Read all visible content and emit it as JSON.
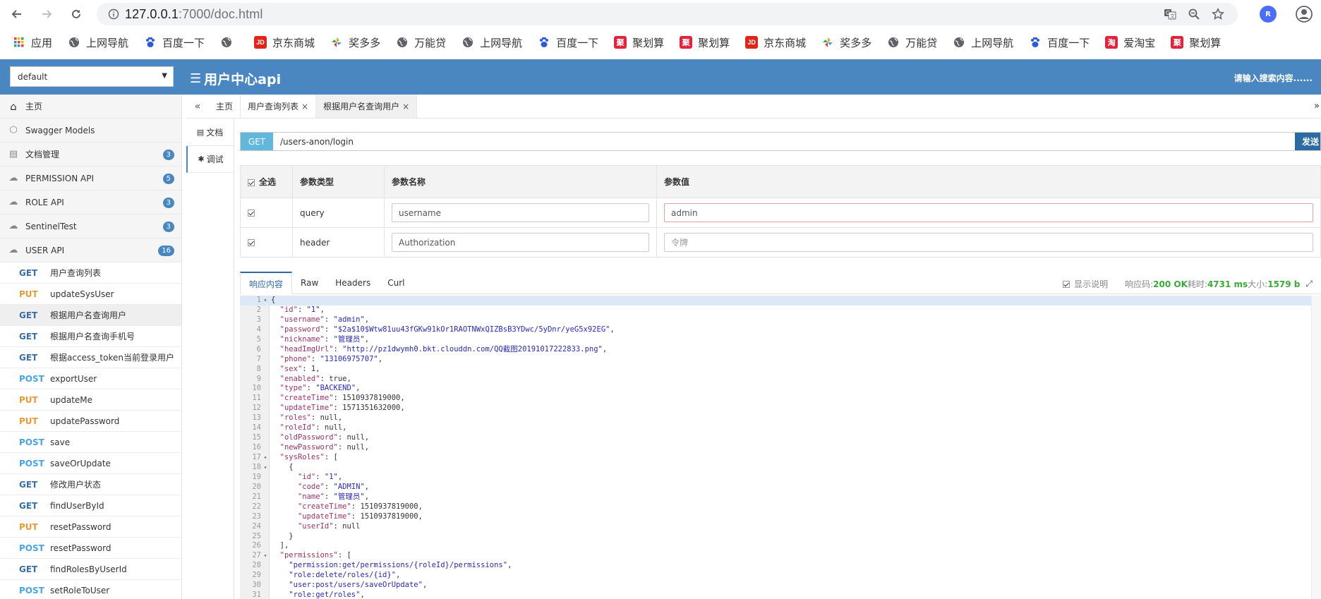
{
  "browser": {
    "url_host": "127.0.0.1",
    "url_rest": ":7000/doc.html",
    "profile_initial": "R",
    "bookmarks": [
      {
        "label": "应用",
        "icon": "apps-grid-icon",
        "color": "#e94335"
      },
      {
        "label": "上网导航",
        "icon": "globe-icon",
        "color": "#5f6368"
      },
      {
        "label": "百度一下",
        "icon": "baidu-paw-icon",
        "color": "#2f5bd9"
      },
      {
        "label": "",
        "icon": "globe-icon",
        "color": "#5f6368"
      },
      {
        "label": "京东商城",
        "icon": "jd-icon",
        "color": "#e1251b"
      },
      {
        "label": "奖多多",
        "icon": "pinwheel-icon",
        "color": "#f0a020"
      },
      {
        "label": "万能贷",
        "icon": "globe-icon",
        "color": "#5f6368"
      },
      {
        "label": "上网导航",
        "icon": "globe-icon",
        "color": "#5f6368"
      },
      {
        "label": "百度一下",
        "icon": "baidu-paw-icon",
        "color": "#2f5bd9"
      },
      {
        "label": "聚划算",
        "icon": "juhuasuan-icon",
        "color": "#e2233c"
      },
      {
        "label": "聚划算",
        "icon": "juhuasuan-icon",
        "color": "#e2233c"
      },
      {
        "label": "京东商城",
        "icon": "jd-icon",
        "color": "#e1251b"
      },
      {
        "label": "奖多多",
        "icon": "pinwheel-icon",
        "color": "#f0a020"
      },
      {
        "label": "万能贷",
        "icon": "globe-icon",
        "color": "#5f6368"
      },
      {
        "label": "上网导航",
        "icon": "globe-icon",
        "color": "#5f6368"
      },
      {
        "label": "百度一下",
        "icon": "baidu-paw-icon",
        "color": "#2f5bd9"
      },
      {
        "label": "爱淘宝",
        "icon": "taobao-icon",
        "color": "#e2233c"
      },
      {
        "label": "聚划算",
        "icon": "juhuasuan-icon",
        "color": "#e2233c"
      }
    ]
  },
  "header": {
    "group_select": "default",
    "title": "用户中心api",
    "search_hint": "请输入搜索内容......",
    "brand_color": "#4a87c0"
  },
  "sidebar": {
    "items": [
      {
        "label": "主页",
        "icon": "home-icon",
        "badge": ""
      },
      {
        "label": "Swagger Models",
        "icon": "cube-icon",
        "badge": ""
      },
      {
        "label": "文档管理",
        "icon": "doc-settings-icon",
        "badge": "3"
      },
      {
        "label": "PERMISSION API",
        "icon": "cloud-icon",
        "badge": "5"
      },
      {
        "label": "ROLE API",
        "icon": "cloud-icon",
        "badge": "3"
      },
      {
        "label": "SentinelTest",
        "icon": "cloud-icon",
        "badge": "3"
      },
      {
        "label": "USER API",
        "icon": "cloud-icon",
        "badge": "16"
      }
    ],
    "apis": [
      {
        "method": "GET",
        "name": "用户查询列表"
      },
      {
        "method": "PUT",
        "name": "updateSysUser"
      },
      {
        "method": "GET",
        "name": "根据用户名查询用户",
        "active": true
      },
      {
        "method": "GET",
        "name": "根据用户名查询手机号"
      },
      {
        "method": "GET",
        "name": "根据access_token当前登录用户"
      },
      {
        "method": "POST",
        "name": "exportUser"
      },
      {
        "method": "PUT",
        "name": "updateMe"
      },
      {
        "method": "PUT",
        "name": "updatePassword"
      },
      {
        "method": "POST",
        "name": "save"
      },
      {
        "method": "POST",
        "name": "saveOrUpdate"
      },
      {
        "method": "GET",
        "name": "修改用户状态"
      },
      {
        "method": "GET",
        "name": "findUserById"
      },
      {
        "method": "PUT",
        "name": "resetPassword"
      },
      {
        "method": "POST",
        "name": "resetPassword"
      },
      {
        "method": "GET",
        "name": "findRolesByUserId"
      },
      {
        "method": "POST",
        "name": "setRoleToUser"
      }
    ]
  },
  "tabs": {
    "collapse_icon": "«",
    "items": [
      {
        "label": "主页",
        "closable": false
      },
      {
        "label": "用户查询列表",
        "closable": true
      },
      {
        "label": "根据用户名查询用户",
        "closable": true,
        "active": true
      }
    ],
    "close_symbol": "×",
    "more_icon": "»"
  },
  "minitabs": [
    {
      "label": "文档",
      "icon": "file-icon"
    },
    {
      "label": "调试",
      "icon": "bug-icon",
      "active": true
    }
  ],
  "request": {
    "method": "GET",
    "path": "/users-anon/login",
    "send_label": "发送"
  },
  "params": {
    "headers": {
      "select_all": "全选",
      "type": "参数类型",
      "name": "参数名称",
      "value": "参数值"
    },
    "rows": [
      {
        "checked": true,
        "type": "query",
        "name": "username",
        "value": "admin",
        "placeholder": ""
      },
      {
        "checked": true,
        "type": "header",
        "name": "Authorization",
        "value": "",
        "placeholder": "令牌"
      }
    ]
  },
  "response": {
    "tabs": [
      "响应内容",
      "Raw",
      "Headers",
      "Curl"
    ],
    "show_desc_label": "显示说明",
    "status_label": "响应码:",
    "status_value": "200 OK",
    "time_label": "耗时:",
    "time_value": "4731 ms",
    "size_label": "大小:",
    "size_value": "1579 b",
    "lines": [
      "{",
      "  \"id\": \"1\",",
      "  \"username\": \"admin\",",
      "  \"password\": \"$2a$10$Wtw81uu43fGKw91kOr1RAOTNWxQIZBsB3YDwc/5yDnr/yeG5x92EG\",",
      "  \"nickname\": \"管理员\",",
      "  \"headImgUrl\": \"http://pz1dwymh0.bkt.clouddn.com/QQ截图20191017222833.png\",",
      "  \"phone\": \"13106975707\",",
      "  \"sex\": 1,",
      "  \"enabled\": true,",
      "  \"type\": \"BACKEND\",",
      "  \"createTime\": 1510937819000,",
      "  \"updateTime\": 1571351632000,",
      "  \"roles\": null,",
      "  \"roleId\": null,",
      "  \"oldPassword\": null,",
      "  \"newPassword\": null,",
      "  \"sysRoles\": [",
      "    {",
      "      \"id\": \"1\",",
      "      \"code\": \"ADMIN\",",
      "      \"name\": \"管理员\",",
      "      \"createTime\": 1510937819000,",
      "      \"updateTime\": 1510937819000,",
      "      \"userId\": null",
      "    }",
      "  ],",
      "  \"permissions\": [",
      "    \"permission:get/permissions/{roleId}/permissions\",",
      "    \"role:delete/roles/{id}\",",
      "    \"user:post/users/saveOrUpdate\",",
      "    \"role:get/roles\","
    ],
    "fold_lines": [
      1,
      17,
      18,
      27
    ]
  }
}
